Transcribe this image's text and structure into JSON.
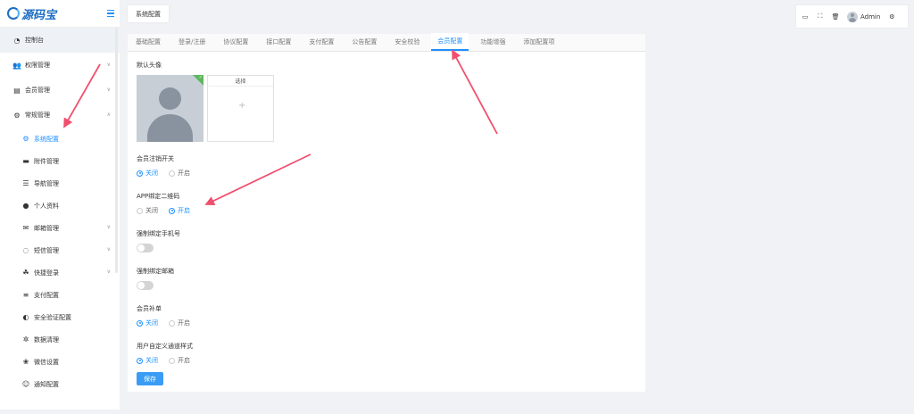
{
  "logo": {
    "text": "源码宝"
  },
  "sidebar": {
    "items": [
      {
        "label": "控制台",
        "icon": "dashboard-icon"
      },
      {
        "label": "权限管理",
        "icon": "users-icon"
      },
      {
        "label": "会员管理",
        "icon": "id-card-icon"
      },
      {
        "label": "常规管理",
        "icon": "gears-icon"
      }
    ],
    "sub_items": [
      {
        "label": "系统配置",
        "icon": "gear-icon"
      },
      {
        "label": "附件管理",
        "icon": "folder-icon"
      },
      {
        "label": "导航管理",
        "icon": "list-icon"
      },
      {
        "label": "个人资料",
        "icon": "user-icon"
      },
      {
        "label": "邮箱管理",
        "icon": "envelope-icon"
      },
      {
        "label": "短信管理",
        "icon": "chat-icon"
      },
      {
        "label": "快捷登录",
        "icon": "handshake-icon"
      },
      {
        "label": "支付配置",
        "icon": "sliders-icon"
      },
      {
        "label": "安全验证配置",
        "icon": "shield-icon"
      },
      {
        "label": "数据清理",
        "icon": "cog-icon"
      },
      {
        "label": "微信设置",
        "icon": "wechat-icon"
      },
      {
        "label": "通知配置",
        "icon": "smile-icon"
      }
    ]
  },
  "page_tab": {
    "label": "系统配置"
  },
  "header": {
    "user": "Admin"
  },
  "tabs": [
    "基础配置",
    "登录/注册",
    "协议配置",
    "接口配置",
    "支付配置",
    "公告配置",
    "安全校验",
    "会员配置",
    "功能增强",
    "添加配置项"
  ],
  "form": {
    "avatar_label": "默认头像",
    "upload_label": "选择",
    "upload_plus": "+",
    "cancel_label": "会员注销开关",
    "qr_label": "APP绑定二维码",
    "phone_label": "强制绑定手机号",
    "email_label": "强制绑定邮箱",
    "refill_label": "会员补单",
    "channel_label": "用户自定义通道样式",
    "off": "关闭",
    "on": "开启",
    "save": "保存"
  },
  "colors": {
    "accent": "#1e90ff",
    "arrow": "#f0506e",
    "button": "#3a9cf5"
  }
}
